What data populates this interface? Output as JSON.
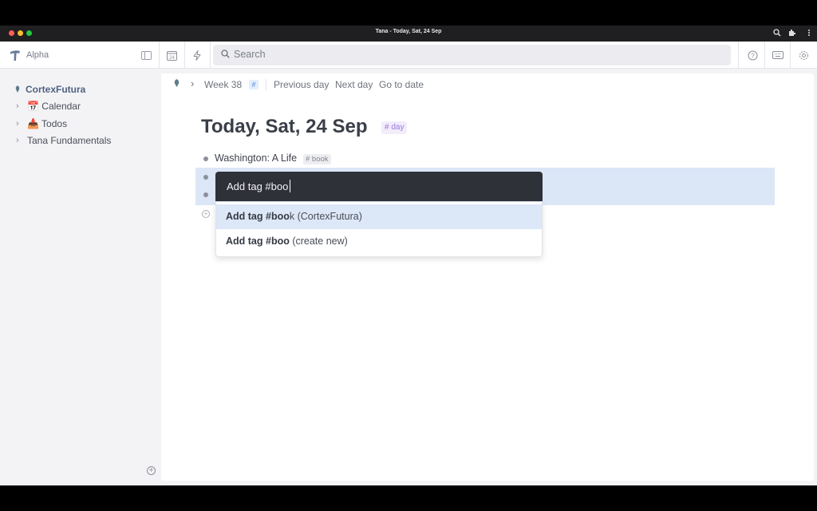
{
  "window": {
    "title": "Tana - Today, Sat, 24 Sep"
  },
  "header": {
    "workspace_name": "Alpha",
    "search_placeholder": "Search",
    "calendar_day": "24",
    "icons": [
      "sidebar-toggle-icon",
      "calendar-icon",
      "lightning-icon",
      "help-icon",
      "keyboard-icon",
      "settings-icon"
    ]
  },
  "sidebar": {
    "root": "CortexFutura",
    "items": [
      {
        "label": "📅 Calendar"
      },
      {
        "label": "📥 Todos"
      },
      {
        "label": "Tana Fundamentals"
      }
    ]
  },
  "breadcrumb": {
    "week": "Week 38",
    "tag_symbol": "#",
    "previous_day": "Previous day",
    "next_day": "Next day",
    "go_to_date": "Go to date"
  },
  "page": {
    "title": "Today, Sat, 24 Sep",
    "title_tag": "# day",
    "nodes": [
      {
        "text": "Washington: A Life",
        "tag": "# book"
      }
    ]
  },
  "command": {
    "input_value": "Add tag #boo",
    "options": [
      {
        "bold": "Add tag #boo",
        "rest": "k (CortexFutura)"
      },
      {
        "bold": "Add tag #boo",
        "rest": " (create new)"
      }
    ]
  },
  "colors": {
    "accent": "#5b8bd6",
    "selection": "#dbe6f6",
    "popup_dark": "#2f3138",
    "day_tag": "#9a78d6"
  }
}
